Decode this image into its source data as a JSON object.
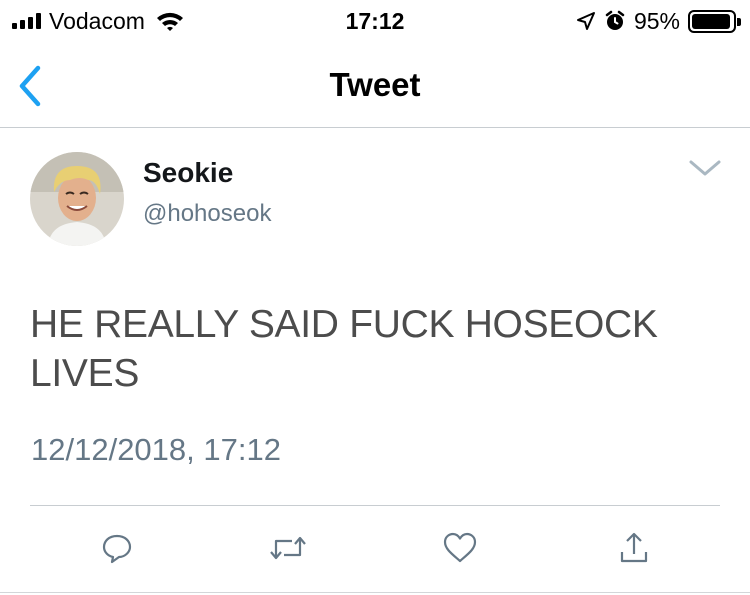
{
  "status_bar": {
    "carrier": "Vodacom",
    "time": "17:12",
    "battery_percent": "95%",
    "battery_level": 0.95,
    "icons": [
      "signal-bars-icon",
      "wifi-icon",
      "location-arrow-icon",
      "alarm-icon",
      "battery-icon"
    ]
  },
  "nav": {
    "title": "Tweet",
    "back_icon": "chevron-left-icon",
    "accent_color": "#1da1f2"
  },
  "tweet": {
    "display_name": "Seokie",
    "username": "@hohoseok",
    "text": "HE REALLY SAID FUCK HOSEOCK LIVES",
    "timestamp": "12/12/2018, 17:12",
    "menu_icon": "chevron-down-icon"
  },
  "actions": [
    {
      "name": "reply",
      "icon": "reply-bubble-icon"
    },
    {
      "name": "retweet",
      "icon": "retweet-icon"
    },
    {
      "name": "like",
      "icon": "heart-icon"
    },
    {
      "name": "share",
      "icon": "share-upload-icon"
    }
  ],
  "colors": {
    "text_primary": "#14171a",
    "text_secondary": "#657786",
    "icon_gray": "#657786",
    "divider": "#c8cdd1"
  }
}
